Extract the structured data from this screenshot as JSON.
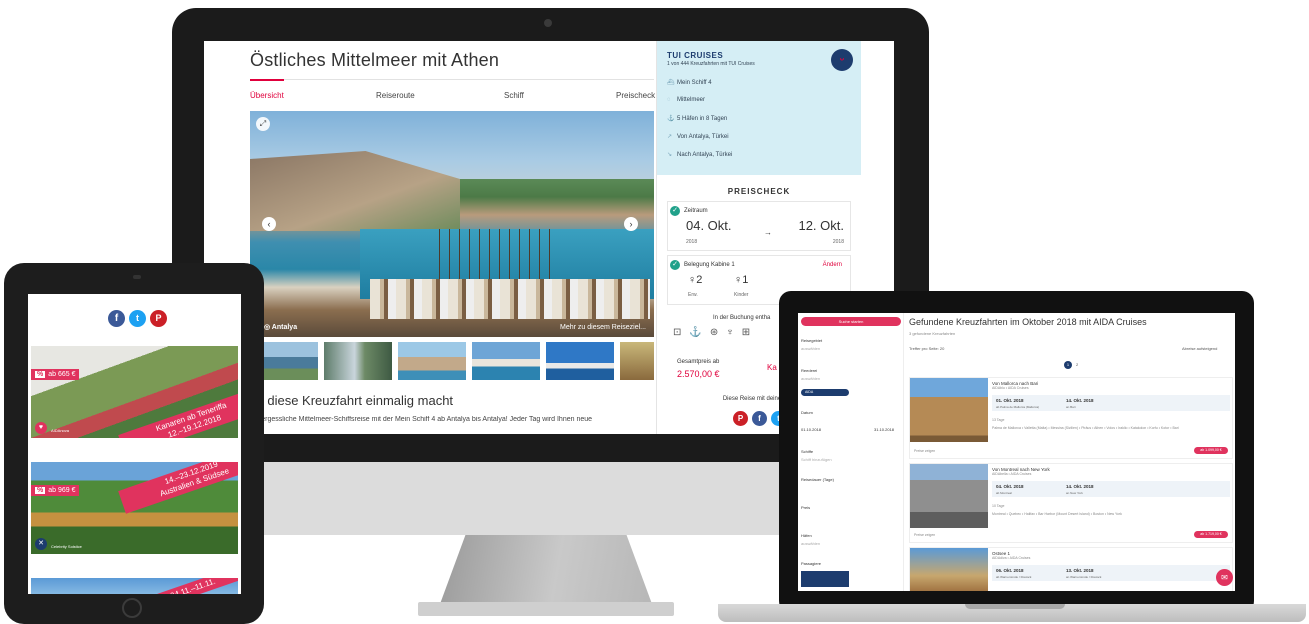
{
  "monitor": {
    "title": "Östliches Mittelmeer mit Athen",
    "tabs": [
      "Übersicht",
      "Reiseroute",
      "Schiff",
      "Preischeck"
    ],
    "hero_caption": "Antalya",
    "hero_more": "Mehr zu diesem Reiseziel...",
    "subtitle": "as diese Kreuzfahrt einmalig macht",
    "body": "unvergessliche Mittelmeer-Schiffsreise mit der Mein Schiff 4 ab Antalya bis Antalya! Jeder Tag wird Ihnen neue",
    "panel": {
      "brand": "TUI CRUISES",
      "brand_sub": "1 von 444 Kreuzfahrten mit TUI Cruises",
      "items": [
        {
          "icon": "ship-icon",
          "label": "Mein Schiff 4"
        },
        {
          "icon": "globe-icon",
          "label": "Mittelmeer"
        },
        {
          "icon": "anchor-icon",
          "label": "5 Häfen in 8 Tagen"
        },
        {
          "icon": "departure-icon",
          "label": "Von Antalya, Türkei"
        },
        {
          "icon": "arrival-icon",
          "label": "Nach Antalya, Türkei"
        }
      ],
      "preischeck": "PREISCHECK",
      "zeitraum": "Zeitraum",
      "from_date": "04. Okt.",
      "from_year": "2018",
      "to_date": "12. Okt.",
      "to_year": "2018",
      "belegung": "Belegung Kabine 1",
      "aendern": "Ändern",
      "adults": "2",
      "adults_lbl": "Erw.",
      "kids": "1",
      "kids_lbl": "Kinder",
      "included": "In der Buchung entha",
      "gesamt_lbl": "Gesamtpreis ab",
      "gesamt": "2.570,00 €",
      "ka": "Ka",
      "share": "Diese Reise mit deinen Fre"
    }
  },
  "tablet": {
    "cards": [
      {
        "price": "ab 665 €",
        "pct": "%",
        "band_1": "Kanaren ab Teneriffa",
        "band_2": "12.–19.12.2018",
        "logo": "AIDAnova"
      },
      {
        "price": "ab 969 €",
        "pct": "%",
        "band_1": "14.–23.12.2019",
        "band_2": "Australien & Südsee",
        "logo": "Celebrity Solstice"
      },
      {
        "band_1": "04.11.–11.11."
      }
    ]
  },
  "laptop": {
    "search_btn": "Suche starten",
    "title": "Gefundene Kreuzfahrten im Oktober 2018 mit AIDA Cruises",
    "subtitle": "3 gefundene Kreuzfahrten",
    "per_page": "Treffer pro Seite:",
    "per_page_val": "20",
    "sort": "Abreise aufsteigend",
    "filters": [
      {
        "label": "Reisegebiet",
        "val": "auswählen"
      },
      {
        "label": "Reederei",
        "val": "auswählen"
      },
      {
        "label": "Datum",
        "val": "01.10.2018"
      },
      {
        "label": "Schiffe",
        "val": "Schiff hinzufügen"
      },
      {
        "label": "Reisedauer (Tage)",
        "val": ""
      },
      {
        "label": "Preis",
        "val": ""
      },
      {
        "label": "Häfen",
        "val": "auswählen"
      },
      {
        "label": "Passagiere",
        "val": ""
      }
    ],
    "chip": "AIDA",
    "date_to": "31.10.2018",
    "results": [
      {
        "name": "Von Mallorca nach Bari",
        "ship": "AIDAblu • AIDA Cruises",
        "d1": "01. Okt. 2018",
        "d1s": "ab Palma de Mallorca (Mallorca)",
        "d2": "14. Okt. 2018",
        "d2s": "an Bari",
        "days": "13 Tage",
        "route": "Palma de Mallorca • Valletta (Malta) • Messina (Sizilien) • Piräus • Athen • Volos • Iraklio • Katakolon • Korfu • Kotor • Bari",
        "price": "ab 1.099,00 €",
        "prices": "Preise zeigen"
      },
      {
        "name": "Von Montreal nach New York",
        "ship": "AIDAbella • AIDA Cruises",
        "d1": "04. Okt. 2018",
        "d1s": "ab Montreal",
        "d2": "14. Okt. 2018",
        "d2s": "an New York",
        "days": "10 Tage",
        "route": "Montreal • Quebec • Halifax • Bar Harbor (Mount Desert Island) • Boston • New York",
        "price": "ab 1.719,00 €",
        "prices": "Preise zeigen"
      },
      {
        "name": "Ostsee 1",
        "ship": "AIDAdiva • AIDA Cruises",
        "d1": "06. Okt. 2018",
        "d1s": "ab Warnemünde / Rostock",
        "d2": "13. Okt. 2018",
        "d2s": "an Warnemünde / Rostock",
        "days": "",
        "route": "",
        "price": "",
        "prices": ""
      }
    ],
    "page": "1",
    "page2": "2"
  }
}
